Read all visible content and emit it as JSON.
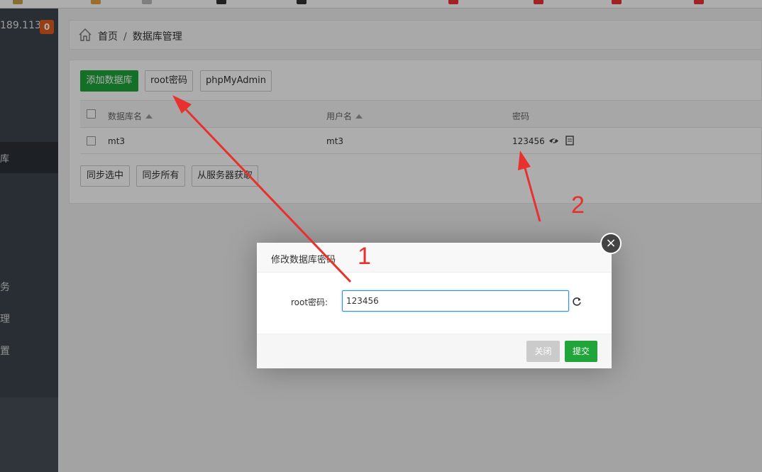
{
  "sidebar": {
    "ip": "189.113",
    "badge": "0",
    "active_item": "库",
    "items": [
      "务",
      "理",
      "置"
    ]
  },
  "breadcrumb": {
    "home": "首页",
    "separator": "/",
    "current": "数据库管理"
  },
  "toolbar": {
    "add_db": "添加数据库",
    "root_password": "root密码",
    "phpmyadmin": "phpMyAdmin"
  },
  "table": {
    "headers": {
      "name": "数据库名",
      "user": "用户名",
      "password": "密码"
    },
    "rows": [
      {
        "name": "mt3",
        "user": "mt3",
        "password": "123456"
      }
    ]
  },
  "bottom_buttons": {
    "sync_selected": "同步选中",
    "sync_all": "同步所有",
    "fetch_server": "从服务器获取"
  },
  "dialog": {
    "title": "修改数据库密码",
    "label": "root密码:",
    "value": "123456",
    "close": "关闭",
    "submit": "提交"
  },
  "annotations": {
    "one": "1",
    "two": "2"
  },
  "colors": {
    "accent_green": "#20a53a",
    "annotation_red": "#e8312e",
    "badge_orange": "#e05c1c",
    "sidebar": "#3c444d"
  }
}
